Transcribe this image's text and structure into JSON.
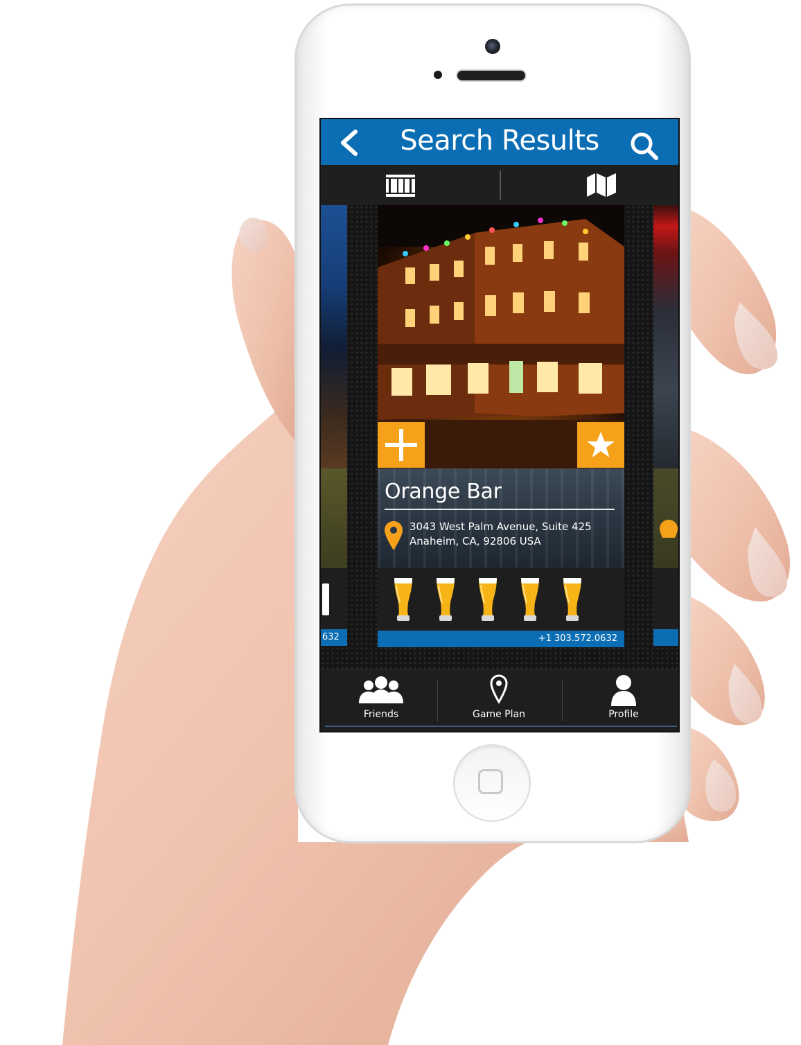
{
  "header": {
    "title": "Search Results"
  },
  "card": {
    "name": "Orange Bar",
    "address_line1": "3043 West Palm Avenue, Suite 425",
    "address_line2": "Anaheim, CA, 92806 USA",
    "rating_beers": 5,
    "phone": "+1 303.572.0632"
  },
  "side_left": {
    "phone_fragment": "632"
  },
  "tabs": [
    {
      "label": "Friends"
    },
    {
      "label": "Game Plan"
    },
    {
      "label": "Profile"
    }
  ],
  "colors": {
    "header_blue": "#0b6db3",
    "accent_orange": "#f5a11a",
    "dark_bg": "#1e1e1e"
  },
  "icons": {
    "back": "chevron-left-icon",
    "search": "search-icon",
    "list_view": "list-view-icon",
    "map_view": "map-icon",
    "add": "plus-icon",
    "favorite": "star-icon",
    "location": "location-pin-icon",
    "rating": "beer-glass-icon",
    "friends": "friends-icon",
    "game_plan": "map-pin-icon",
    "profile": "profile-icon"
  }
}
